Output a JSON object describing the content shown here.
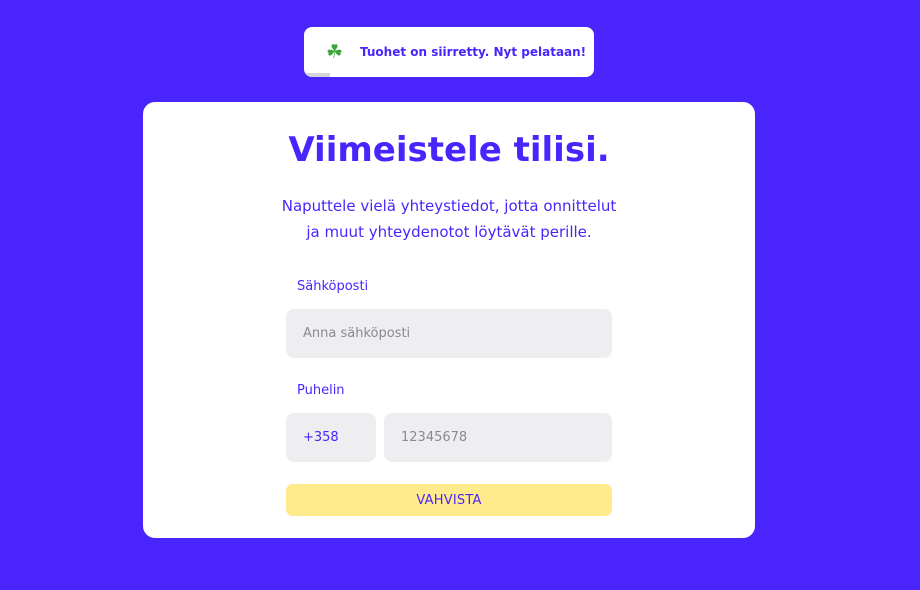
{
  "toast": {
    "icon": "clover-icon",
    "message": "Tuohet on siirretty. Nyt pelataan!"
  },
  "form": {
    "title": "Viimeistele tilisi.",
    "subtitle_line1": "Naputtele vielä yhteystiedot, jotta onnittelut",
    "subtitle_line2": "ja muut yhteydenotot löytävät perille.",
    "email_label": "Sähköposti",
    "email_placeholder": "Anna sähköposti",
    "email_value": "",
    "phone_label": "Puhelin",
    "phone_prefix": "+358",
    "phone_placeholder": "12345678",
    "phone_value": "",
    "submit_label": "VAHVISTA"
  },
  "colors": {
    "background": "#4a25fb",
    "accent": "#4a25fb",
    "button": "#ffeb8c",
    "input_bg": "#eeedf0"
  }
}
